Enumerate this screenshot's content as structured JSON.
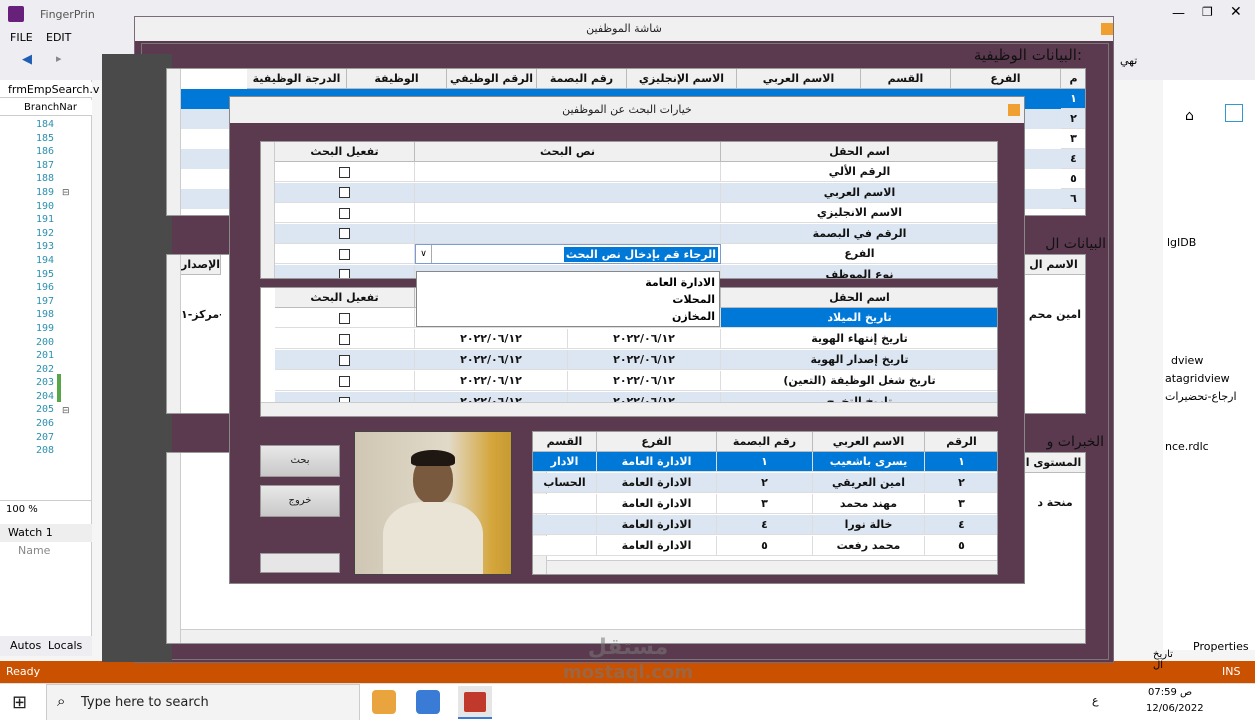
{
  "vs": {
    "title": "FingerPrin",
    "menu": [
      "FILE",
      "EDIT"
    ],
    "tab": "frmEmpSearch.v",
    "dropdown": "BranchNar",
    "line_numbers": [
      "184",
      "185",
      "186",
      "187",
      "188",
      "189",
      "190",
      "191",
      "192",
      "193",
      "194",
      "195",
      "196",
      "197",
      "198",
      "199",
      "200",
      "201",
      "202",
      "203",
      "204",
      "205",
      "206",
      "207",
      "208"
    ],
    "zoom": "100 %",
    "watch_label": "Watch 1",
    "watch_col": "Name",
    "bottom_tabs": [
      "Autos",
      "Locals"
    ],
    "status": "Ready",
    "status_ins": "INS",
    "right_items": [
      "lgIDB",
      "dview",
      "atagridview",
      "ارجاع-تحضيرات",
      "nce.rdlc"
    ],
    "properties": "Properties"
  },
  "taskbar": {
    "search_placeholder": "Type here to search",
    "time": "07:59 ص",
    "date": "12/06/2022",
    "lang": "ع"
  },
  "employee": {
    "title": "شاشة الموظفين",
    "section_job": "البيانات الوظيفية:",
    "section_other": "البيانات ال",
    "section_exp": "الخبرات و",
    "job_headers": [
      "م",
      "الفرع",
      "القسم",
      "الاسم العربي",
      "الاسم الإنجليزي",
      "رقم البصمة",
      "الرقم الوظيفي",
      "الوظيفة",
      "الدرجة الوظيفية"
    ],
    "job_rows": [
      "١",
      "٢",
      "٣",
      "٤",
      "٥",
      "٦"
    ],
    "side_text_1": "امين محم",
    "side_text_2": "مركز-١-",
    "side_text_3": "منحة د",
    "hdr_name": "الاسم ال",
    "hdr_issue": "الإصدار",
    "hdr_level": "المستوى ا",
    "bottom_right": "تاريخ ال"
  },
  "search": {
    "title": "خيارات البحث عن الموظفين",
    "grid1_headers": [
      "اسم الحقل",
      "نص البحث",
      "تفعيل البحث"
    ],
    "grid1_rows": [
      "الرقم الألي",
      "الاسم العربي",
      "الاسم الانجليزي",
      "الرقم في البصمة",
      "الفرع",
      "نوع الموظف"
    ],
    "combo_value": "الرجاء قم بإدخال نص البحث",
    "combo_options": [
      "الادارة العامة",
      "المحلات",
      "المخازن"
    ],
    "grid2_headers": [
      "اسم الحقل",
      "",
      "تفعيل البحث"
    ],
    "grid2_rows": [
      {
        "field": "تاريخ الميلاد",
        "from": "",
        "to": ""
      },
      {
        "field": "تاريخ إنتهاء الهوية",
        "from": "٢٠٢٢/٠٦/١٢",
        "to": "٢٠٢٢/٠٦/١٢"
      },
      {
        "field": "تاريخ إصدار الهوية",
        "from": "٢٠٢٢/٠٦/١٢",
        "to": "٢٠٢٢/٠٦/١٢"
      },
      {
        "field": "تاريخ شغل الوظيفة (التعين)",
        "from": "٢٠٢٢/٠٦/١٢",
        "to": "٢٠٢٢/٠٦/١٢"
      },
      {
        "field": "تاريخ التخرج",
        "from": "٢٠٢٢/٠٦/١٢",
        "to": "٢٠٢٢/٠٦/١٢"
      }
    ],
    "search_btn": "بحث",
    "exit_btn": "خروج",
    "results_headers": [
      "الرقم",
      "الاسم العربي",
      "رقم البصمة",
      "الفرع",
      "القسم"
    ],
    "results": [
      {
        "id": "١",
        "name": "يسرى باشعيب",
        "fp": "١",
        "branch": "الادارة العامة",
        "dept": "الادار"
      },
      {
        "id": "٢",
        "name": "امين العريقي",
        "fp": "٢",
        "branch": "الادارة العامة",
        "dept": "الحساب"
      },
      {
        "id": "٣",
        "name": "مهند محمد",
        "fp": "٣",
        "branch": "الادارة العامة",
        "dept": ""
      },
      {
        "id": "٤",
        "name": "خالة نورا",
        "fp": "٤",
        "branch": "الادارة العامة",
        "dept": ""
      },
      {
        "id": "٥",
        "name": "محمد رفعت",
        "fp": "٥",
        "branch": "الادارة العامة",
        "dept": ""
      }
    ]
  },
  "watermark": "مستقل mostaql.com",
  "colors": {
    "dialog_bg": "#5b3a50",
    "selection": "#0078d7",
    "alt_row": "#dce6f2",
    "status_bar": "#ca5100"
  }
}
